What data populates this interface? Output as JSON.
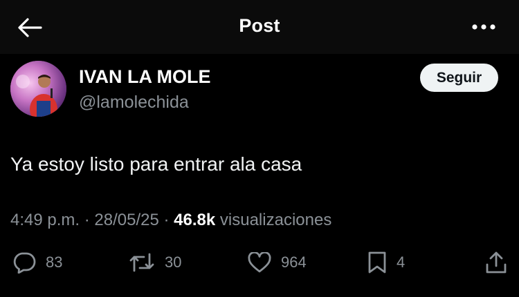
{
  "header": {
    "title": "Post",
    "back_icon": "arrow-left-icon",
    "more_icon": "more-horizontal-icon"
  },
  "author": {
    "name": "IVAN LA MOLE",
    "handle": "@lamolechida",
    "follow_label": "Seguir"
  },
  "post": {
    "text": "Ya estoy listo para entrar ala casa",
    "time": "4:49 p.m.",
    "separator": "·",
    "date": "28/05/25",
    "views_count": "46.8k",
    "views_label": "visualizaciones"
  },
  "actions": {
    "replies": {
      "icon": "reply-icon",
      "count": "83"
    },
    "reposts": {
      "icon": "repost-icon",
      "count": "30"
    },
    "likes": {
      "icon": "heart-icon",
      "count": "964"
    },
    "bookmarks": {
      "icon": "bookmark-icon",
      "count": "4"
    },
    "share": {
      "icon": "share-icon"
    }
  },
  "colors": {
    "background": "#000000",
    "header_background": "#0b0b0b",
    "primary_text": "#ffffff",
    "secondary_text": "#8b9197",
    "follow_button_bg": "#eff3f4"
  }
}
